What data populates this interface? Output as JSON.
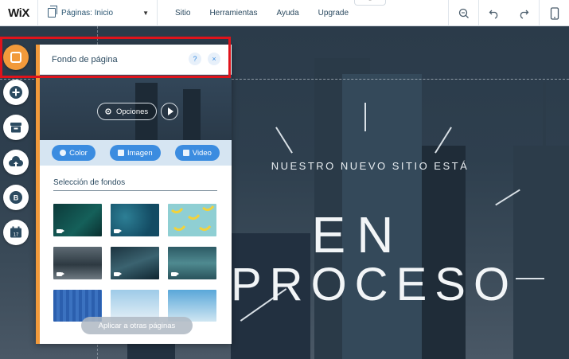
{
  "topbar": {
    "logo": "WiX",
    "pages_label": "Páginas: Inicio",
    "menu": [
      "Sitio",
      "Herramientas",
      "Ayuda",
      "Upgrade"
    ],
    "icons": [
      "zoom-icon",
      "undo-icon",
      "redo-icon",
      "mobile-icon"
    ]
  },
  "hero": {
    "subtitle": "NUESTRO NUEVO SITIO ESTÁ",
    "line1": "EN",
    "line2": "PROCESO"
  },
  "left_tools": [
    "background-icon",
    "add-icon",
    "store-icon",
    "upload-icon",
    "blog-icon",
    "calendar-icon"
  ],
  "panel": {
    "title": "Fondo de página",
    "help": "?",
    "close": "×",
    "options_label": "Opciones",
    "type_buttons": [
      "Color",
      "Imagen",
      "Video"
    ],
    "selection_label": "Selección de fondos",
    "apply_label": "Aplicar a otras páginas"
  },
  "colors": {
    "accent_orange": "#f29a3b",
    "accent_blue": "#3b8ce0",
    "highlight_red": "#e0131b"
  }
}
